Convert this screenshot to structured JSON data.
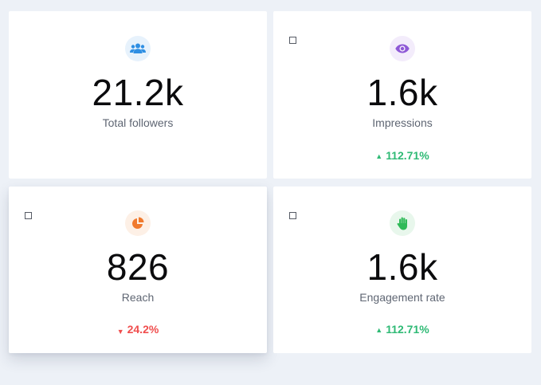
{
  "cards": [
    {
      "value": "21.2k",
      "label": "Total followers",
      "icon": "users-icon",
      "icon_color": "#2f8fe3",
      "icon_bg": "#e7f2fc"
    },
    {
      "value": "1.6k",
      "label": "Impressions",
      "icon": "eye-icon",
      "icon_color": "#8e58d6",
      "icon_bg": "#f3ecfb",
      "delta": "112.71%",
      "delta_direction": "up",
      "delta_arrow": "▲"
    },
    {
      "value": "826",
      "label": "Reach",
      "icon": "pie-chart-icon",
      "icon_color": "#f07a2e",
      "icon_bg": "#fdf0e6",
      "delta": "24.2%",
      "delta_direction": "down",
      "delta_arrow": "▼"
    },
    {
      "value": "1.6k",
      "label": "Engagement rate",
      "icon": "hand-icon",
      "icon_color": "#2fba58",
      "icon_bg": "#e8f7ec",
      "delta": "112.71%",
      "delta_direction": "up",
      "delta_arrow": "▲"
    }
  ],
  "colors": {
    "background": "#edf1f7",
    "up": "#2fba75",
    "down": "#f04e4e"
  }
}
